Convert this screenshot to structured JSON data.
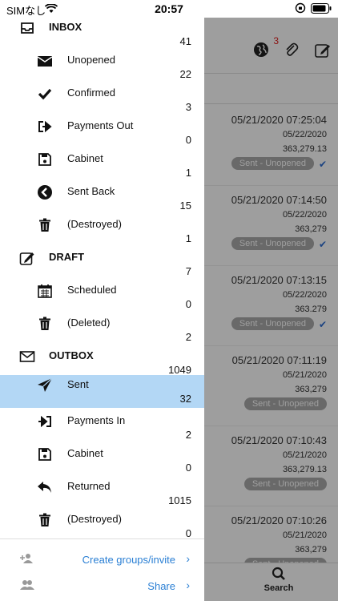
{
  "status_bar": {
    "carrier": "SIMなし",
    "time": "20:57"
  },
  "header": {
    "badge": "3"
  },
  "messages": [
    {
      "datetime": "05/21/2020 07:25:04",
      "date2": "05/22/2020",
      "amount": "363,279.13",
      "status": "Sent - Unopened",
      "checked": true
    },
    {
      "datetime": "05/21/2020 07:14:50",
      "date2": "05/22/2020",
      "amount": "363,279",
      "status": "Sent - Unopened",
      "checked": true
    },
    {
      "datetime": "05/21/2020 07:13:15",
      "date2": "05/22/2020",
      "amount": "363.279",
      "status": "Sent - Unopened",
      "checked": true
    },
    {
      "datetime": "05/21/2020 07:11:19",
      "date2": "05/21/2020",
      "amount": "363,279",
      "status": "Sent - Unopened",
      "checked": false
    },
    {
      "datetime": "05/21/2020 07:10:43",
      "date2": "05/21/2020",
      "amount": "363,279.13",
      "status": "Sent - Unopened",
      "checked": false
    },
    {
      "datetime": "05/21/2020 07:10:26",
      "date2": "05/21/2020",
      "amount": "363,279",
      "status": "Sent - Unopened",
      "checked": false
    }
  ],
  "tabbar": {
    "search_label": "Search"
  },
  "drawer": {
    "items": [
      {
        "label": "INBOX",
        "count": "41",
        "icon": "inbox-icon"
      },
      {
        "label": "Unopened",
        "count": "22",
        "icon": "envelope-icon"
      },
      {
        "label": "Confirmed",
        "count": "3",
        "icon": "check-icon"
      },
      {
        "label": "Payments Out",
        "count": "0",
        "icon": "sign-out-icon"
      },
      {
        "label": "Cabinet",
        "count": "1",
        "icon": "floppy-icon"
      },
      {
        "label": "Sent Back",
        "count": "15",
        "icon": "arrow-left-circle-icon"
      },
      {
        "label": "(Destroyed)",
        "count": "1",
        "icon": "trash-icon"
      },
      {
        "label": "DRAFT",
        "count": "7",
        "icon": "edit-icon"
      },
      {
        "label": "Scheduled",
        "count": "0",
        "icon": "calendar-icon"
      },
      {
        "label": "(Deleted)",
        "count": "2",
        "icon": "trash-icon"
      },
      {
        "label": "OUTBOX",
        "count": "1049",
        "icon": "envelope-outline-icon"
      },
      {
        "label": "Sent",
        "count": "32",
        "icon": "paper-plane-icon"
      },
      {
        "label": "Payments In",
        "count": "2",
        "icon": "sign-in-icon"
      },
      {
        "label": "Cabinet",
        "count": "0",
        "icon": "floppy-icon"
      },
      {
        "label": "Returned",
        "count": "1015",
        "icon": "reply-icon"
      },
      {
        "label": "(Destroyed)",
        "count": "0",
        "icon": "trash-icon"
      }
    ],
    "footer": {
      "create_groups_label": "Create groups/invite",
      "share_label": "Share"
    }
  }
}
